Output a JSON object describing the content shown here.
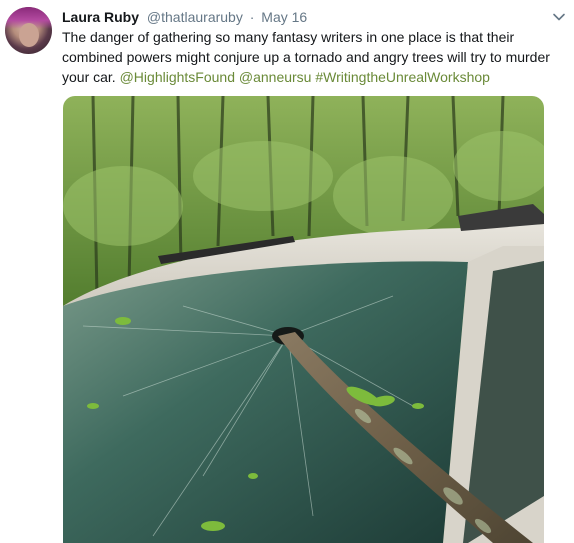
{
  "tweet": {
    "author": {
      "display_name": "Laura Ruby",
      "handle": "@thatlauraruby"
    },
    "separator": "·",
    "date": "May 16",
    "text_parts": {
      "body": "The danger of gathering so many fantasy writers in one place is that their combined powers might conjure up a tornado and angry trees will try to murder your car. ",
      "mention_1": "@HighlightsFound",
      "mention_2": "@anneursu",
      "hashtag": "#WritingtheUnrealWorkshop"
    },
    "icons": {
      "menu": "chevron-down-icon",
      "avatar": "avatar"
    },
    "colors": {
      "link": "#6a8a38",
      "muted": "#657786",
      "text": "#14171a"
    }
  }
}
